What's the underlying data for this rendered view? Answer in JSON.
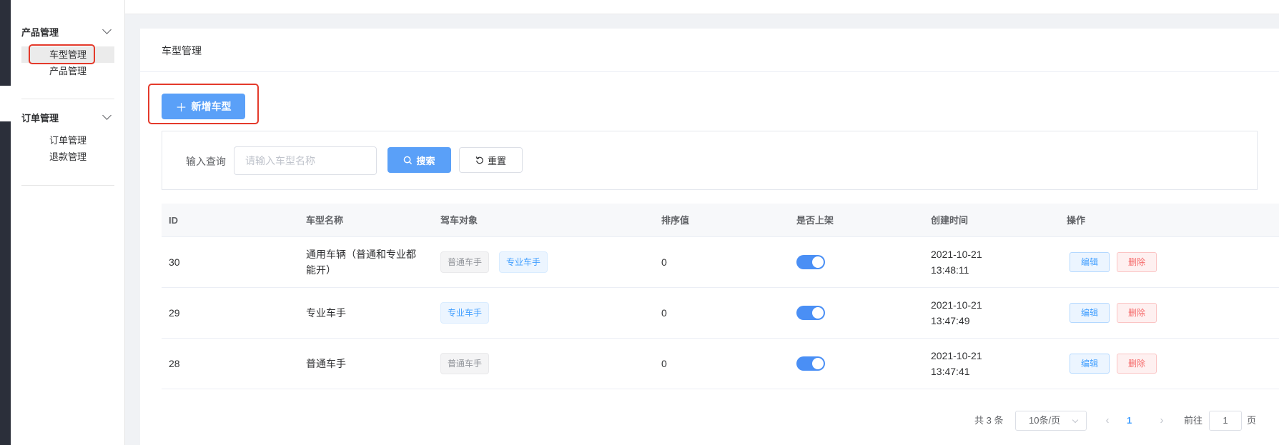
{
  "sidebar": {
    "groups": [
      {
        "title": "产品管理",
        "items": [
          {
            "label": "车型管理",
            "active": true
          },
          {
            "label": "产品管理",
            "active": false
          }
        ]
      },
      {
        "title": "订单管理",
        "items": [
          {
            "label": "订单管理",
            "active": false
          },
          {
            "label": "退款管理",
            "active": false
          }
        ]
      }
    ]
  },
  "page": {
    "title": "车型管理",
    "add_button": "新增车型"
  },
  "search": {
    "label": "输入查询",
    "placeholder": "请输入车型名称",
    "search_button": "搜索",
    "reset_button": "重置"
  },
  "table": {
    "columns": [
      "ID",
      "车型名称",
      "驾车对象",
      "排序值",
      "是否上架",
      "创建时间",
      "操作"
    ],
    "rows": [
      {
        "id": "30",
        "name": "通用车辆（普通和专业都能开）",
        "tags": [
          {
            "label": "普通车手",
            "style": "gray"
          },
          {
            "label": "专业车手",
            "style": "blue"
          }
        ],
        "sort": "0",
        "on_shelf": true,
        "date": "2021-10-21",
        "time": "13:48:11",
        "edit": "编辑",
        "delete": "删除"
      },
      {
        "id": "29",
        "name": "专业车手",
        "tags": [
          {
            "label": "专业车手",
            "style": "blue"
          }
        ],
        "sort": "0",
        "on_shelf": true,
        "date": "2021-10-21",
        "time": "13:47:49",
        "edit": "编辑",
        "delete": "删除"
      },
      {
        "id": "28",
        "name": "普通车手",
        "tags": [
          {
            "label": "普通车手",
            "style": "gray"
          }
        ],
        "sort": "0",
        "on_shelf": true,
        "date": "2021-10-21",
        "time": "13:47:41",
        "edit": "编辑",
        "delete": "删除"
      }
    ]
  },
  "pagination": {
    "total": "共 3 条",
    "page_size": "10条/页",
    "current_page": "1",
    "goto_label": "前往",
    "goto_value": "1",
    "page_suffix": "页"
  },
  "colors": {
    "primary": "#5aa0f8",
    "highlight_border": "#e43a2b",
    "switch_on": "#4a8ff5"
  }
}
